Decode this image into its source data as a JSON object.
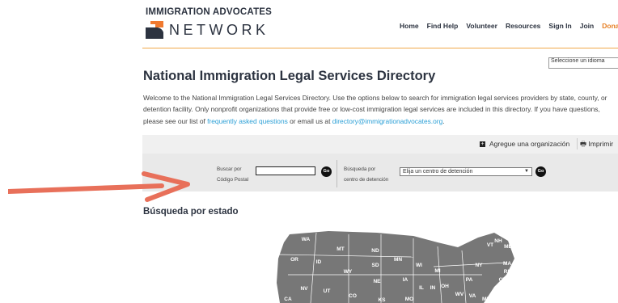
{
  "logo": {
    "top": "IMMIGRATION ADVOCATES",
    "word": "NETWORK"
  },
  "nav": [
    "Home",
    "Find Help",
    "Volunteer",
    "Resources",
    "Sign In",
    "Join",
    "Donat"
  ],
  "language_select": {
    "value": "Seleccione un idioma"
  },
  "page_title": "National Immigration Legal Services Directory",
  "intro": {
    "text1": "Welcome to the National Immigration Legal Services Directory. Use the options below to search for immigration legal services providers by state, county, or detention facility. Only nonprofit organizations that provide free or low-cost immigration legal services are included in this directory. If you have questions, please see our list of ",
    "faq_link": "frequently asked questions",
    "text2": " or email us at ",
    "email_link": "directory@immigrationadvocates.org",
    "text3": "."
  },
  "toolbar": {
    "add_org": "Agregue una organización",
    "print": "Imprimir"
  },
  "search": {
    "zip_label_1": "Buscar por",
    "zip_label_2": "Código Postal",
    "go": "Go",
    "det_label_1": "Búsqueda por",
    "det_label_2": "centro de detención",
    "det_select": "Elija un centro de detención"
  },
  "section_title": "Búsqueda por estado",
  "map_states": [
    "WA",
    "MT",
    "ND",
    "OR",
    "ID",
    "SD",
    "MN",
    "WI",
    "MI",
    "NY",
    "VT",
    "NH",
    "ME",
    "MA",
    "RI",
    "CT",
    "NJ",
    "DE",
    "WY",
    "NE",
    "IA",
    "PA",
    "NV",
    "UT",
    "CO",
    "IL",
    "IN",
    "OH",
    "WV",
    "VA",
    "MD",
    "CA",
    "KS",
    "MO"
  ],
  "colors": {
    "accent": "#f0a84a",
    "link": "#2a9fd6",
    "map": "#777777",
    "arrow": "#e8705a",
    "navy": "#2c3340"
  }
}
